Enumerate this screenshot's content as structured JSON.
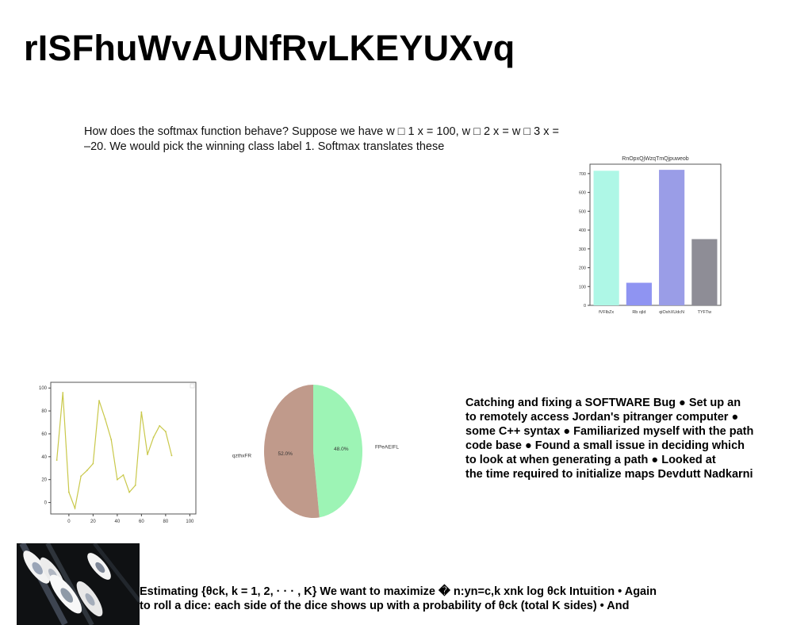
{
  "header": {
    "title": "rISFhuWvAUNfRvLKEYUXvq"
  },
  "main": {
    "paragraph": "How does the softmax function behave? Suppose we have w □ 1 x = 100, w □ 2 x = w □ 3 x = –20. We would pick the winning class label 1. Softmax translates these",
    "right_text": "Catching and fixing a SOFTWARE Bug ● Set up an\nto remotely access Jordan's pitranger computer ●\nsome C++ syntax ● Familiarized myself with the path\ncode base ● Found a small issue in deciding which\nto look at when generating a path ● Looked at\nthe time required to initialize maps Devdutt Nadkarni",
    "bottom_text": "Estimating {θck, k = 1, 2, · · · , K} We want to maximize � n:yn=c,k xnk log θck Intuition • Again\nto roll a dice: each side of the dice shows up with a probability of θck (total K sides) • And"
  },
  "photo": {
    "icon": "boats-marina-icon"
  },
  "chart_data": [
    {
      "type": "bar",
      "title": "RnOpxQjWzqTmQjpuweob",
      "categories": [
        "fVFlbZx",
        "Rb ojld",
        "qiOshXUdcN",
        "TYFTw"
      ],
      "values": [
        715,
        120,
        720,
        352
      ],
      "colors": [
        "#aef7e6",
        "#8f94f2",
        "#9a9de7",
        "#8e8d96"
      ],
      "ylim": [
        0,
        750
      ],
      "yticks": [
        0,
        100,
        200,
        300,
        400,
        500,
        600,
        700
      ],
      "grid": false
    },
    {
      "type": "line",
      "x": [
        -10,
        -5,
        0,
        5,
        10,
        15,
        20,
        25,
        30,
        35,
        40,
        45,
        50,
        55,
        60,
        65,
        70,
        75,
        80,
        85,
        90,
        95,
        100
      ],
      "values": [
        37,
        96,
        9,
        -5,
        23,
        28,
        34,
        89,
        73,
        55,
        20,
        24,
        9,
        15,
        79,
        42,
        57,
        67,
        62,
        41
      ],
      "xlim": [
        -15,
        105
      ],
      "ylim": [
        -10,
        105
      ],
      "xticks": [
        0,
        20,
        40,
        60,
        80,
        100
      ],
      "yticks": [
        0,
        20,
        40,
        60,
        80,
        100
      ],
      "color": "#c9c84a",
      "legend": "top-right"
    },
    {
      "type": "pie",
      "labels": [
        "FPeAEIFL",
        "qzthxFR"
      ],
      "values": [
        48.0,
        52.0
      ],
      "percent_labels": [
        "48.0%",
        "52.0%"
      ],
      "colors": [
        "#9df4b5",
        "#c09a8b"
      ]
    }
  ]
}
